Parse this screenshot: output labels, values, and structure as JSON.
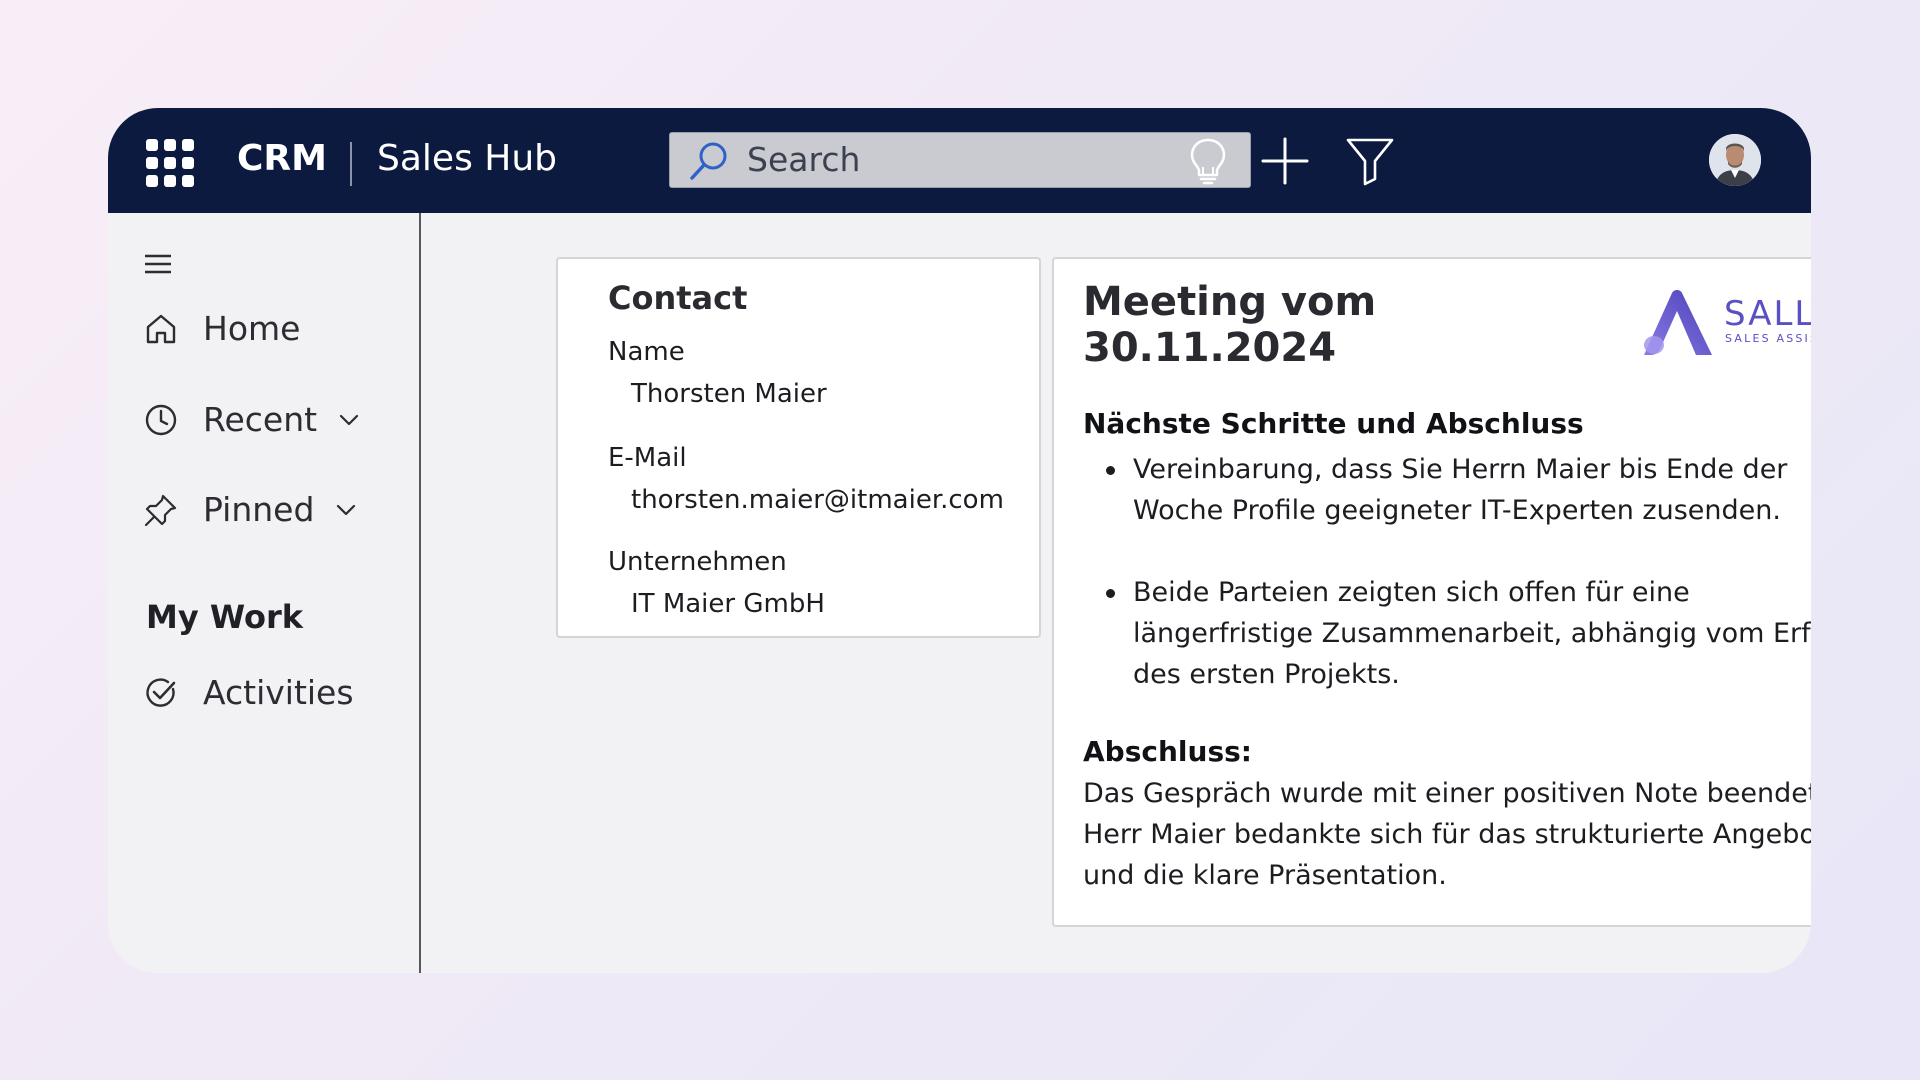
{
  "header": {
    "brand": "CRM",
    "app_name": "Sales Hub",
    "search": {
      "placeholder": "Search"
    },
    "icons": [
      "waffle-icon",
      "lightbulb-icon",
      "plus-icon",
      "filter-icon"
    ],
    "user_avatar": "avatar"
  },
  "sidebar": {
    "items": [
      {
        "label": "Home",
        "icon": "home-icon"
      },
      {
        "label": "Recent",
        "icon": "clock-icon",
        "expandable": true
      },
      {
        "label": "Pinned",
        "icon": "pin-icon",
        "expandable": true
      }
    ],
    "section_title": "My Work",
    "work_items": [
      {
        "label": "Activities",
        "icon": "check-circle-icon"
      }
    ]
  },
  "contact": {
    "title": "Contact",
    "fields": [
      {
        "label": "Name",
        "value": "Thorsten Maier"
      },
      {
        "label": "E-Mail",
        "value": "thorsten.maier@itmaier.com"
      },
      {
        "label": "Unternehmen",
        "value": "IT Maier GmbH"
      }
    ]
  },
  "meeting": {
    "title": "Meeting vom 30.11.2024",
    "logo": {
      "name": "SALLY",
      "tagline": "SALES ASSISTANT"
    },
    "next_steps_title": "Nächste Schritte und Abschluss",
    "next_steps": [
      "Vereinbarung, dass Sie Herrn Maier bis Ende der Woche Profile geeigneter IT-Experten zusenden.",
      "Beide Parteien zeigten sich offen für eine längerfristige Zusammenarbeit, abhängig vom Erfolg des ersten Projekts."
    ],
    "closing_title": "Abschluss:",
    "closing_text": "Das Gespräch wurde mit einer positiven Note beendet, Herr Maier bedankte sich für das strukturierte Angebot und die klare Präsentation."
  },
  "colors": {
    "topbar": "#0b1a3e",
    "search_bg": "#c9cbd1",
    "accent_blue": "#2f62c9",
    "logo_purple": "#5b4fc4"
  }
}
